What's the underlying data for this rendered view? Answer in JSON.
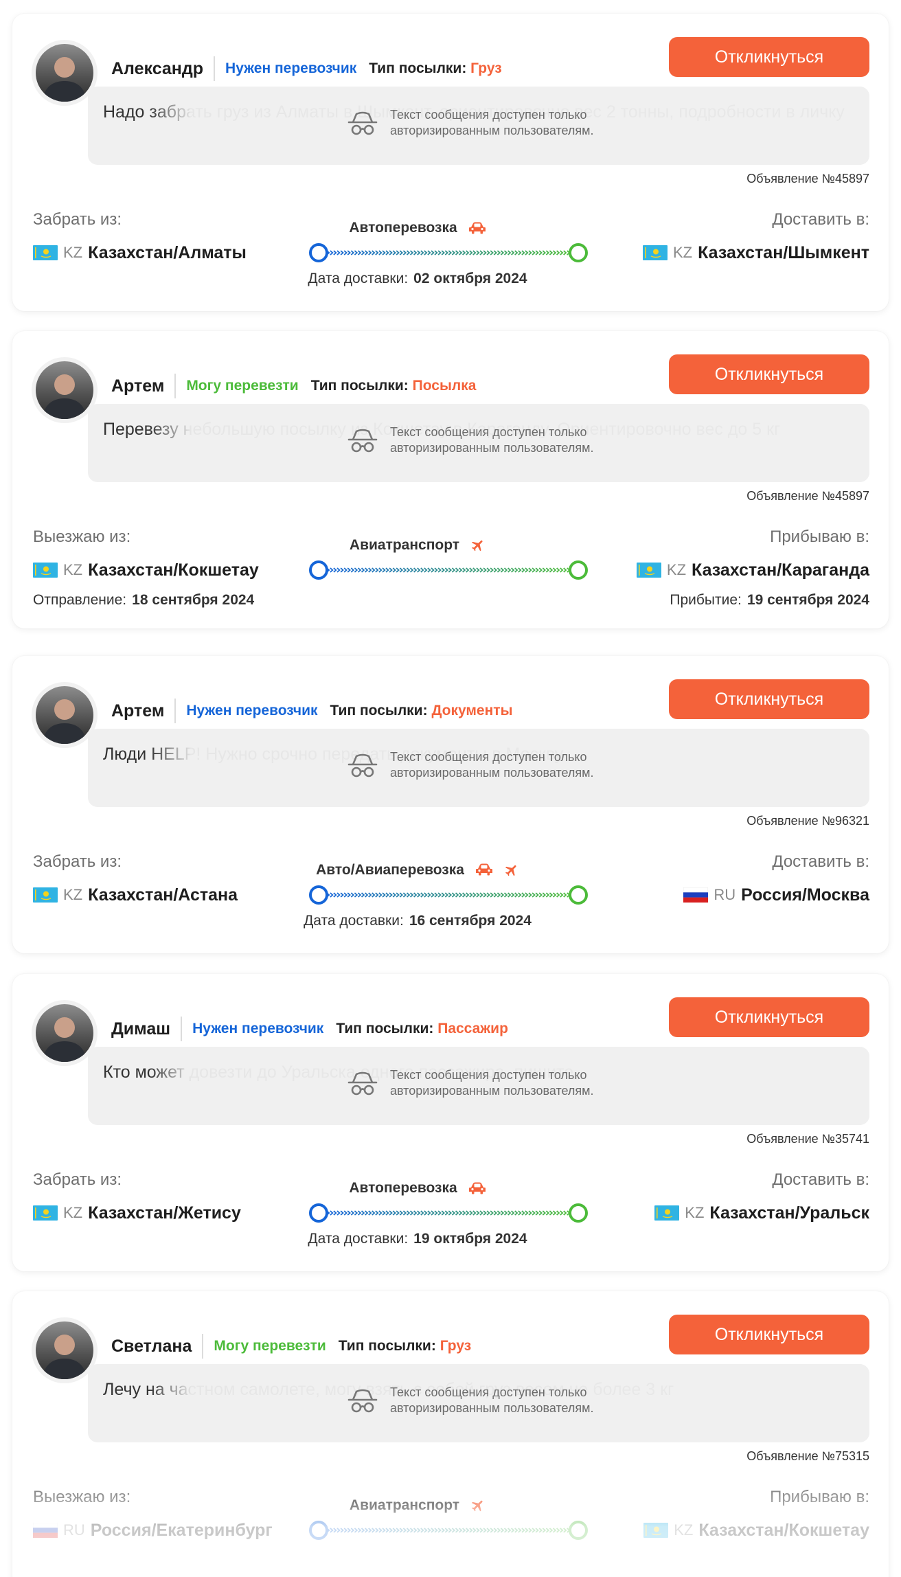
{
  "common": {
    "respond_label": "Откликнуться",
    "locked_line1": "Текст сообщения доступен только",
    "locked_line2": "авторизированным пользователям.",
    "ptype_label": "Тип посылки:",
    "delivery_date_label": "Дата доставки:",
    "depart_label": "Отправление:",
    "arrive_label": "Прибытие:"
  },
  "colors": {
    "accent": "#f4623a",
    "need": "#1565d8",
    "can": "#4cbb3a",
    "route_start": "#1565d8",
    "route_end": "#4cbb3a"
  },
  "cards": [
    {
      "name": "Александр",
      "role": "Нужен перевозчик",
      "role_type": "need",
      "ptype": "Груз",
      "message": "Надо забрать груз из Алматы в Шымкент, ориентировочно вес 2 тонны, подробности в личку",
      "ad": "Объявление №45897",
      "from_label": "Забрать из:",
      "to_label": "Доставить в:",
      "from_cc": "KZ",
      "from_city": "Казахстан/Алматы",
      "from_flag": "kz",
      "to_cc": "KZ",
      "to_city": "Казахстан/Шымкент",
      "to_flag": "kz",
      "transport": "Автоперевозка",
      "icons": [
        "car-icon"
      ],
      "date_mode": "center",
      "date": "02 октября 2024"
    },
    {
      "name": "Артем",
      "role": "Могу перевезти",
      "role_type": "can",
      "ptype": "Посылка",
      "message": "Перевезу небольшую посылку из Кокшетау в Караганду. Ориентировочно вес до 5 кг",
      "ad": "Объявление №45897",
      "from_label": "Выезжаю из:",
      "to_label": "Прибываю в:",
      "from_cc": "KZ",
      "from_city": "Казахстан/Кокшетау",
      "from_flag": "kz",
      "to_cc": "KZ",
      "to_city": "Казахстан/Караганда",
      "to_flag": "kz",
      "transport": "Авиатранспорт",
      "icons": [
        "plane-icon"
      ],
      "date_mode": "sides",
      "depart": "18 сентября 2024",
      "arrive": "19 сентября 2024"
    },
    {
      "name": "Артем",
      "role": "Нужен перевозчик",
      "role_type": "need",
      "ptype": "Документы",
      "message": "Люди HELP! Нужно срочно передать документы в Москву",
      "ad": "Объявление №96321",
      "from_label": "Забрать из:",
      "to_label": "Доставить в:",
      "from_cc": "KZ",
      "from_city": "Казахстан/Астана",
      "from_flag": "kz",
      "to_cc": "RU",
      "to_city": "Россия/Москва",
      "to_flag": "ru",
      "transport": "Авто/Авиаперевозка",
      "icons": [
        "car-icon",
        "plane-icon"
      ],
      "date_mode": "center",
      "date": "16 сентября 2024"
    },
    {
      "name": "Димаш",
      "role": "Нужен перевозчик",
      "role_type": "need",
      "ptype": "Пассажир",
      "message": "Кто может довезти до Уральска одного пассажира, пишите",
      "ad": "Объявление №35741",
      "from_label": "Забрать из:",
      "to_label": "Доставить в:",
      "from_cc": "KZ",
      "from_city": "Казахстан/Жетису",
      "from_flag": "kz",
      "to_cc": "KZ",
      "to_city": "Казахстан/Уральск",
      "to_flag": "kz",
      "transport": "Автоперевозка",
      "icons": [
        "car-icon"
      ],
      "date_mode": "center",
      "date": "19 октября 2024"
    },
    {
      "name": "Светлана",
      "role": "Могу перевезти",
      "role_type": "can",
      "ptype": "Груз",
      "message": "Лечу на частном самолете, могу взять с собой груз весом не более 3 кг",
      "ad": "Объявление №75315",
      "from_label": "Выезжаю из:",
      "to_label": "Прибываю в:",
      "from_cc": "RU",
      "from_city": "Россия/Екатеринбург",
      "from_flag": "ru",
      "to_cc": "KZ",
      "to_city": "Казахстан/Кокшетау",
      "to_flag": "kz",
      "transport": "Авиатранспорт",
      "icons": [
        "plane-icon"
      ],
      "date_mode": "none"
    }
  ]
}
